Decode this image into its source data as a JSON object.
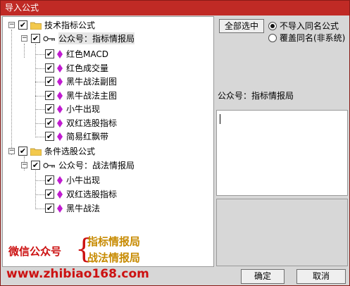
{
  "window": {
    "title": "导入公式"
  },
  "tree": {
    "groups": [
      {
        "label": "技术指标公式",
        "checked": true,
        "child": {
          "label": "公众号：指标情报局",
          "checked": true,
          "items": [
            "红色MACD",
            "红色成交量",
            "黑牛战法副图",
            "黑牛战法主图",
            "小牛出现",
            "双红选股指标",
            "简易红飘带"
          ]
        }
      },
      {
        "label": "条件选股公式",
        "checked": true,
        "child": {
          "label": "公众号：战法情报局",
          "checked": true,
          "items": [
            "小牛出现",
            "双红选股指标",
            "黑牛战法"
          ]
        }
      }
    ],
    "expander_symbol": "−",
    "check_symbol": "✔"
  },
  "promo": {
    "left": "微信公众号",
    "brace": "{",
    "line1": "指标情报局",
    "line2": "战法情报局",
    "url": "www.zhibiao168.com",
    "red": "#cc1111",
    "gold": "#c78a00"
  },
  "right_panel": {
    "select_all_label": "全部选中",
    "radio_options": [
      {
        "label": "不导入同名公式",
        "selected": true
      },
      {
        "label": "覆盖同名(非系统)",
        "selected": false
      }
    ],
    "info_label": "公众号：指标情报局"
  },
  "footer": {
    "ok_label": "确定",
    "cancel_label": "取消"
  },
  "colors": {
    "title_bar": "#c02a25",
    "dialog_bg": "#d7d7d7",
    "icon_gem": "#c01bd0",
    "folder": "#f3c94d"
  }
}
